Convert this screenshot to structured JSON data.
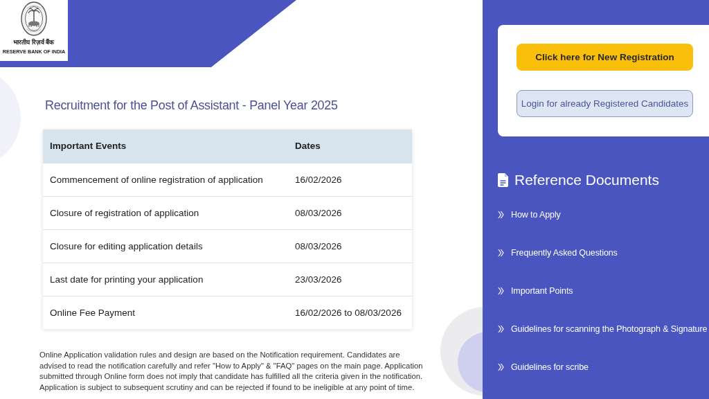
{
  "logo": {
    "hindi_name": "भारतीय रिज़र्व बैंक",
    "english_name": "RESERVE BANK OF INDIA"
  },
  "page_title": "Recruitment for the Post of Assistant - Panel Year 2025",
  "events_table": {
    "columns": [
      "Important Events",
      "Dates"
    ],
    "rows": [
      [
        "Commencement of online registration of application",
        "16/02/2026"
      ],
      [
        "Closure of registration of application",
        "08/03/2026"
      ],
      [
        "Closure for editing application details",
        "08/03/2026"
      ],
      [
        "Last date for printing your application",
        "23/03/2026"
      ],
      [
        "Online Fee Payment",
        "16/02/2026 to 08/03/2026"
      ]
    ]
  },
  "notice": "Online Application validation rules and design are based on the Notification requirement. Candidates are advised to read the notification carefully and refer \"How to Apply\" & \"FAQ\" pages on the main page. Application submitted through Online form does not imply that candidate has fulfilled all the criteria given in the notification. Application is subject to subsequent scrutiny and can be rejected if found to be ineligible at any point of time.",
  "registration_panel": {
    "buttons": [
      {
        "label": "Click here for New Registration",
        "kind": "primary"
      },
      {
        "label": "Login for already Registered Candidates",
        "kind": "secondary"
      }
    ]
  },
  "reference_documents": {
    "title": "Reference Documents",
    "links": [
      "How to Apply",
      "Frequently Asked Questions",
      "Important Points",
      "Guidelines for scanning the Photograph & Signature",
      "Guidelines for scribe"
    ]
  }
}
